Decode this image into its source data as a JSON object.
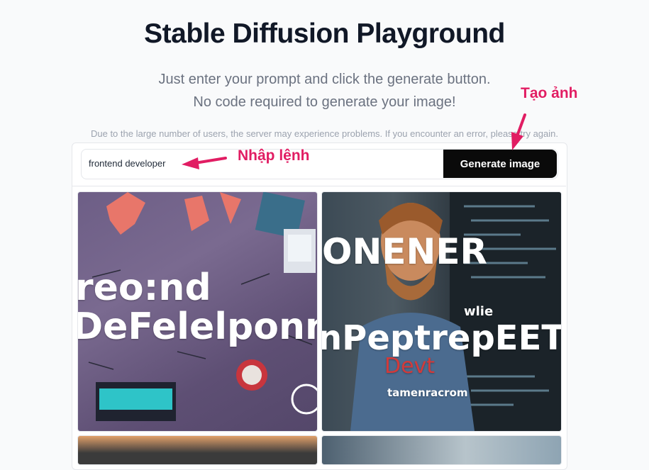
{
  "header": {
    "title": "Stable Diffusion Playground",
    "subtitle_line1": "Just enter your prompt and click the generate button.",
    "subtitle_line2": "No code required to generate your image!",
    "notice": "Due to the large number of users, the server may experience problems. If you encounter an error, please try again."
  },
  "form": {
    "prompt_value": "frontend developer",
    "generate_label": "Generate image"
  },
  "annotations": {
    "generate": "Tạo ảnh",
    "prompt": "Nhập lệnh",
    "color": "#e11d63"
  },
  "results": {
    "image1": {
      "line1": "reo:nd",
      "line2": "DeFelelponne"
    },
    "image2": {
      "line1": "ONENER",
      "line2": "nPeptrepEET",
      "line3": "Devt",
      "line4": "wlie",
      "line5": "tamenracrom"
    }
  },
  "colors": {
    "button_bg": "#0a0a0a",
    "title": "#111827",
    "subtitle": "#6b7280"
  }
}
